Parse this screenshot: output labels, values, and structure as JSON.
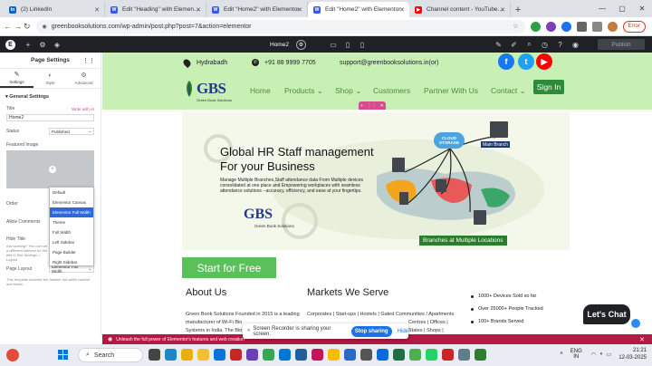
{
  "browser": {
    "tabs": [
      {
        "title": "(2) LinkedIn",
        "icon": "linkedin-icon",
        "color": "#0a66c2",
        "glyph": "in"
      },
      {
        "title": "Edit \"Heading\" with Elementor",
        "icon": "wordpress-icon",
        "color": "#3858e9",
        "glyph": "W"
      },
      {
        "title": "Edit \"Home2\" with Elementor",
        "icon": "wordpress-icon",
        "color": "#3858e9",
        "glyph": "W"
      },
      {
        "title": "Edit \"Home2\" with Elementor",
        "icon": "wordpress-icon",
        "color": "#3858e9",
        "glyph": "W",
        "active": true
      },
      {
        "title": "Channel content - YouTube Stu",
        "icon": "youtube-icon",
        "color": "#ff0000",
        "glyph": "▶"
      }
    ],
    "url": "greenbooksolutions.com/wp-admin/post.php?post=7&action=elementor",
    "error_label": "Error"
  },
  "elementor": {
    "page_name": "Home2",
    "publish_label": "Publish"
  },
  "panel": {
    "title": "Page Settings",
    "tabs": [
      {
        "label": "Settings",
        "icon": "✎"
      },
      {
        "label": "Style",
        "icon": "◐"
      },
      {
        "label": "Advanced",
        "icon": "⚙"
      }
    ],
    "section": "General Settings",
    "title_label": "Title",
    "write_ai": "Write with AI",
    "title_value": "Home2",
    "status_label": "Status",
    "status_value": "Published",
    "featured_label": "Featured Image",
    "order_label": "Order",
    "allow_comments_label": "Allow Comments",
    "hide_title_label": "Hide Title",
    "hide_title_help": "Not working? You can set a different selector for the title in Site Settings > Layout",
    "page_layout_label": "Page Layout",
    "page_layout_value": "Elementor Full Width",
    "layout_help": "This template includes the header, full-width content and footer",
    "layout_options": [
      "Default",
      "Elementor Canvas",
      "Elementor Full Width",
      "Theme",
      "Full Width",
      "Left Sidebar",
      "Page Builder",
      "Right Sidebar"
    ],
    "layout_selected_index": 2
  },
  "site": {
    "location": "Hydrabadh",
    "phone": "+91 88 9999 7705",
    "email": "support@greenbooksolutions.in(or)",
    "logo_text": "GBS",
    "logo_sub": "Green Book Solutions",
    "nav": [
      "Home",
      "Products",
      "Shop",
      "Customers",
      "Partner With Us",
      "Contact"
    ],
    "signin": "Sign In",
    "banner": {
      "heading_line1": "Global HR Staff management",
      "heading_line2": "For your Business",
      "body": "Manage Multiple Branches,Staff attendance data From Multiple devices consolidated at one place and Empowering workplaces with seamless attendance solutions --accuracy, efficiency, and ease at your fingertips.",
      "cloud_label": "CLOUD STORAGE",
      "main_branch": "Main Branch",
      "branches_label": "Branches at Multiple Locations"
    },
    "start_label": "Start for Free",
    "about_heading": "About Us",
    "about_text": "Green Book Solutions Founded in 2015 is a leading manufacturer of Wi-Fi Bio",
    "about_text2": "Systems in India. The Bio",
    "markets_heading": "Markets We Serve",
    "markets_text": "Corporates | Start-ups | Hostels | Gated Communities / Apartments",
    "markets_text2": "Centres | Offices |",
    "markets_text3": "States | Shops |",
    "stats": [
      "1000+ Devices Sold so far",
      "Over 25000+ People Tracked",
      "100+ Brands Served"
    ],
    "chat_label": "Let's Chat"
  },
  "promo_text": "Unleash the full power of Elementor's features and web creation",
  "recorder": {
    "text": "Screen Recorder is sharing your screen.",
    "stop": "Stop sharing",
    "hide": "Hide"
  },
  "taskbar": {
    "search": "Search",
    "lang_top": "ENG",
    "lang_bottom": "IN",
    "time": "21:21",
    "date": "12-03-2025"
  }
}
